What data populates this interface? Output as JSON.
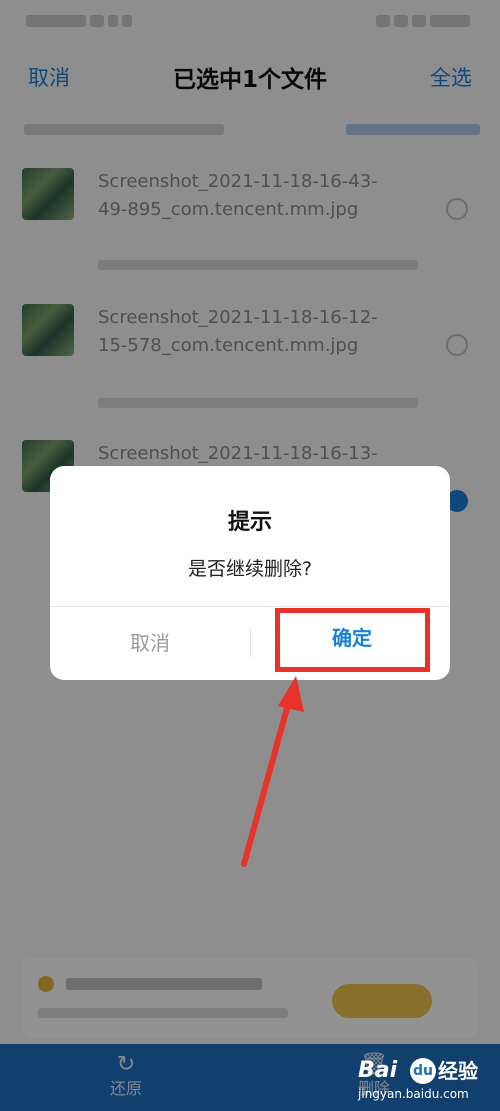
{
  "nav": {
    "cancel": "取消",
    "title": "已选中1个文件",
    "select_all": "全选"
  },
  "files": [
    {
      "name_line1": "Screenshot_2021-11-18-16-43-",
      "name_line2": "49-895_com.tencent.mm.jpg",
      "checked": false
    },
    {
      "name_line1": "Screenshot_2021-11-18-16-12-",
      "name_line2": "15-578_com.tencent.mm.jpg",
      "checked": false
    },
    {
      "name_line1": "Screenshot_2021-11-18-16-13-",
      "name_line2": "",
      "checked": true
    }
  ],
  "bottom_bar": {
    "restore_label": "还原",
    "delete_label": "删除"
  },
  "dialog": {
    "title": "提示",
    "message": "是否继续删除?",
    "cancel": "取消",
    "confirm": "确定"
  },
  "watermark": {
    "logo": "Bai",
    "paw": "du",
    "cn": "经验",
    "url": "jingyan.baidu.com"
  },
  "colors": {
    "accent": "#1a7fd6",
    "bottom_bar": "#1f6fbd",
    "annotation": "#e8332b"
  }
}
